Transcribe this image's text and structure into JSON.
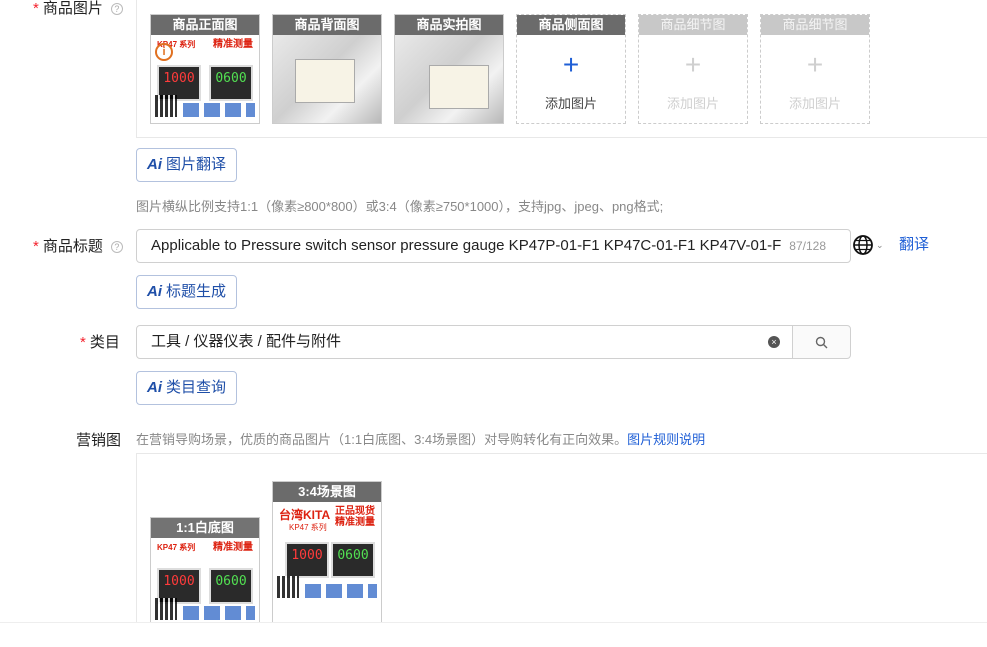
{
  "product_images": {
    "label": "商品图片",
    "slots": [
      {
        "caption": "商品正面图",
        "kind": "product"
      },
      {
        "caption": "商品背面图",
        "kind": "photo"
      },
      {
        "caption": "商品实拍图",
        "kind": "photo"
      },
      {
        "caption": "商品侧面图",
        "kind": "add",
        "add_label": "添加图片"
      },
      {
        "caption": "商品细节图",
        "kind": "add-disabled",
        "add_label": "添加图片"
      },
      {
        "caption": "商品细节图",
        "kind": "add-disabled",
        "add_label": "添加图片"
      }
    ],
    "ai_translate_label": "图片翻译",
    "hint": "图片横纵比例支持1:1（像素≥800*800）或3:4（像素≥750*1000），支持jpg、jpeg、png格式;"
  },
  "product_title": {
    "label": "商品标题",
    "value": "Applicable to Pressure switch sensor pressure gauge KP47P-01-F1 KP47C-01-F1 KP47V-01-F",
    "counter": "87/128",
    "translate_label": "翻译",
    "ai_generate_label": "标题生成"
  },
  "category": {
    "label": "类目",
    "value": "工具 / 仪器仪表 / 配件与附件",
    "ai_query_label": "类目查询"
  },
  "marketing": {
    "label": "营销图",
    "hint": "在营销导购场景，优质的商品图片（1:1白底图、3:4场景图）对导购转化有正向效果。",
    "rule_link": "图片规则说明",
    "images": [
      {
        "caption": "1:1白底图"
      },
      {
        "caption": "3:4场景图"
      }
    ]
  },
  "product_art": {
    "brand": "台湾KITA",
    "series": "KP47 系列",
    "slogan_1": "正品现货",
    "slogan_2": "精准测量",
    "meter_1": "1000",
    "meter_2": "0600"
  },
  "colors": {
    "accent": "#1f5fd6",
    "required": "#f5222d"
  }
}
